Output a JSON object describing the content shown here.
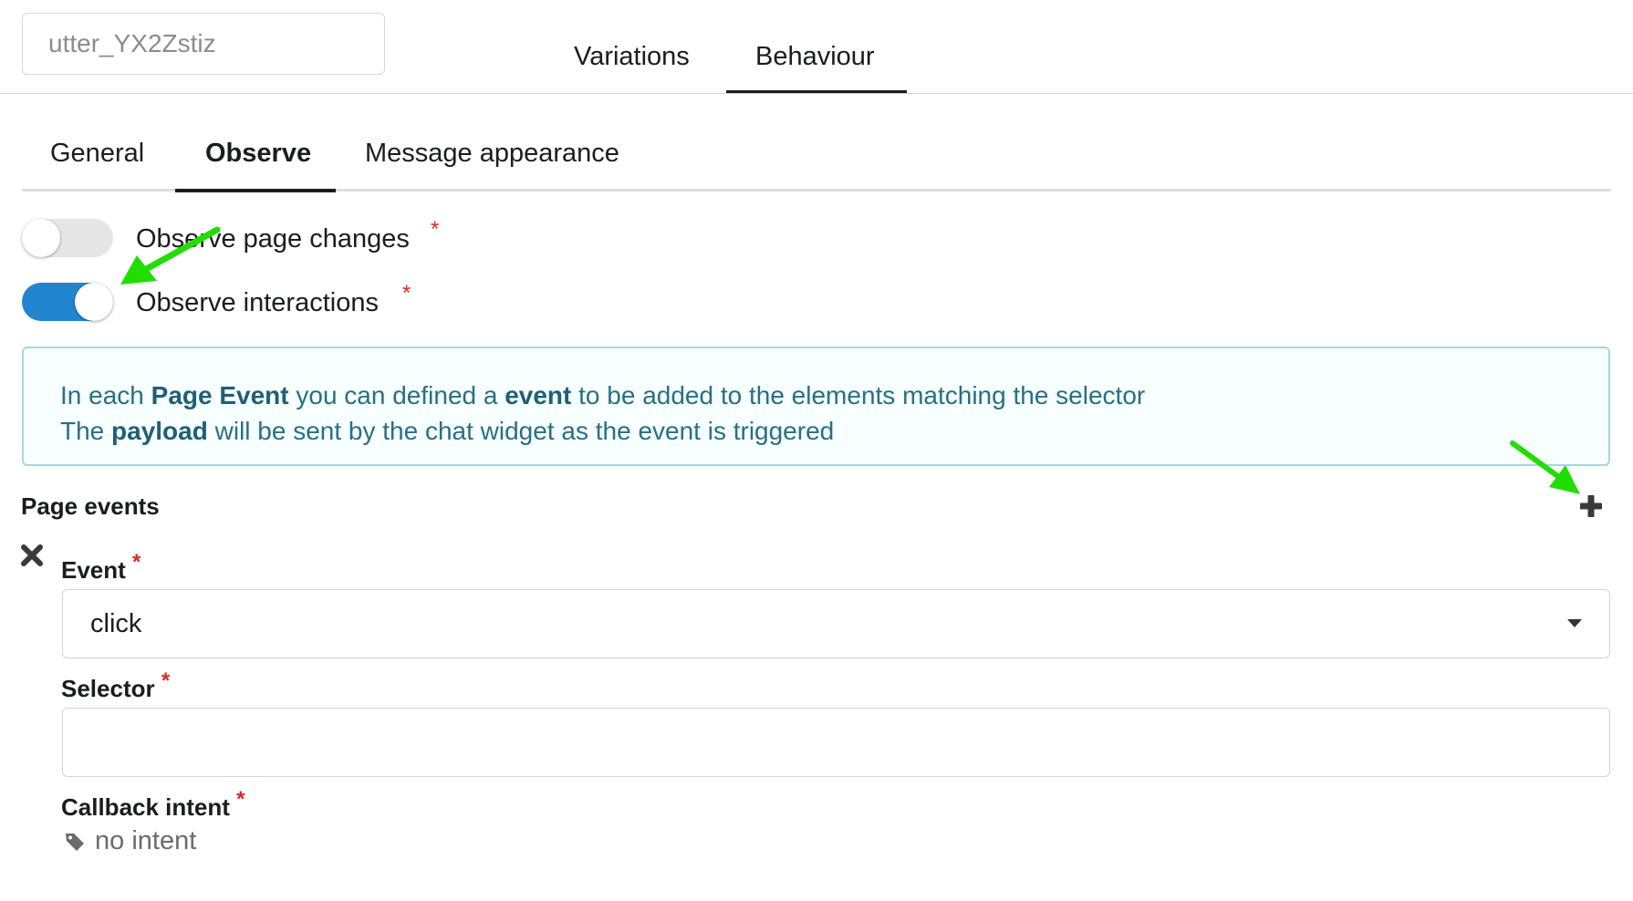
{
  "header": {
    "name_value": "utter_YX2Zstiz",
    "tabs": [
      {
        "label": "Variations",
        "active": false
      },
      {
        "label": "Behaviour",
        "active": true
      }
    ]
  },
  "subtabs": [
    {
      "label": "General",
      "active": false
    },
    {
      "label": "Observe",
      "active": true
    },
    {
      "label": "Message appearance",
      "active": false
    }
  ],
  "toggles": [
    {
      "label": "Observe page changes",
      "on": false,
      "required_mark": "*"
    },
    {
      "label": "Observe interactions",
      "on": true,
      "required_mark": "*"
    }
  ],
  "info": {
    "line1_pre": "In each ",
    "line1_b1": "Page Event",
    "line1_mid": " you can defined a ",
    "line1_b2": "event",
    "line1_post": " to be added to the elements matching the selector",
    "line2_pre": "The ",
    "line2_b": "payload",
    "line2_post": " will be sent by the chat widget as the event is triggered"
  },
  "page_events": {
    "title": "Page events",
    "event_label": "Event",
    "event_value": "click",
    "selector_label": "Selector",
    "selector_value": "",
    "callback_label": "Callback intent",
    "callback_value": "no intent",
    "required_mark": "*"
  },
  "colors": {
    "toggle_on": "#2185d0",
    "info_text": "#276f86",
    "required": "#db2828",
    "annotation_arrow": "#22dd00"
  },
  "icons": [
    "plus-icon",
    "close-icon",
    "tag-icon",
    "dropdown-icon",
    "arrow-annotation"
  ]
}
